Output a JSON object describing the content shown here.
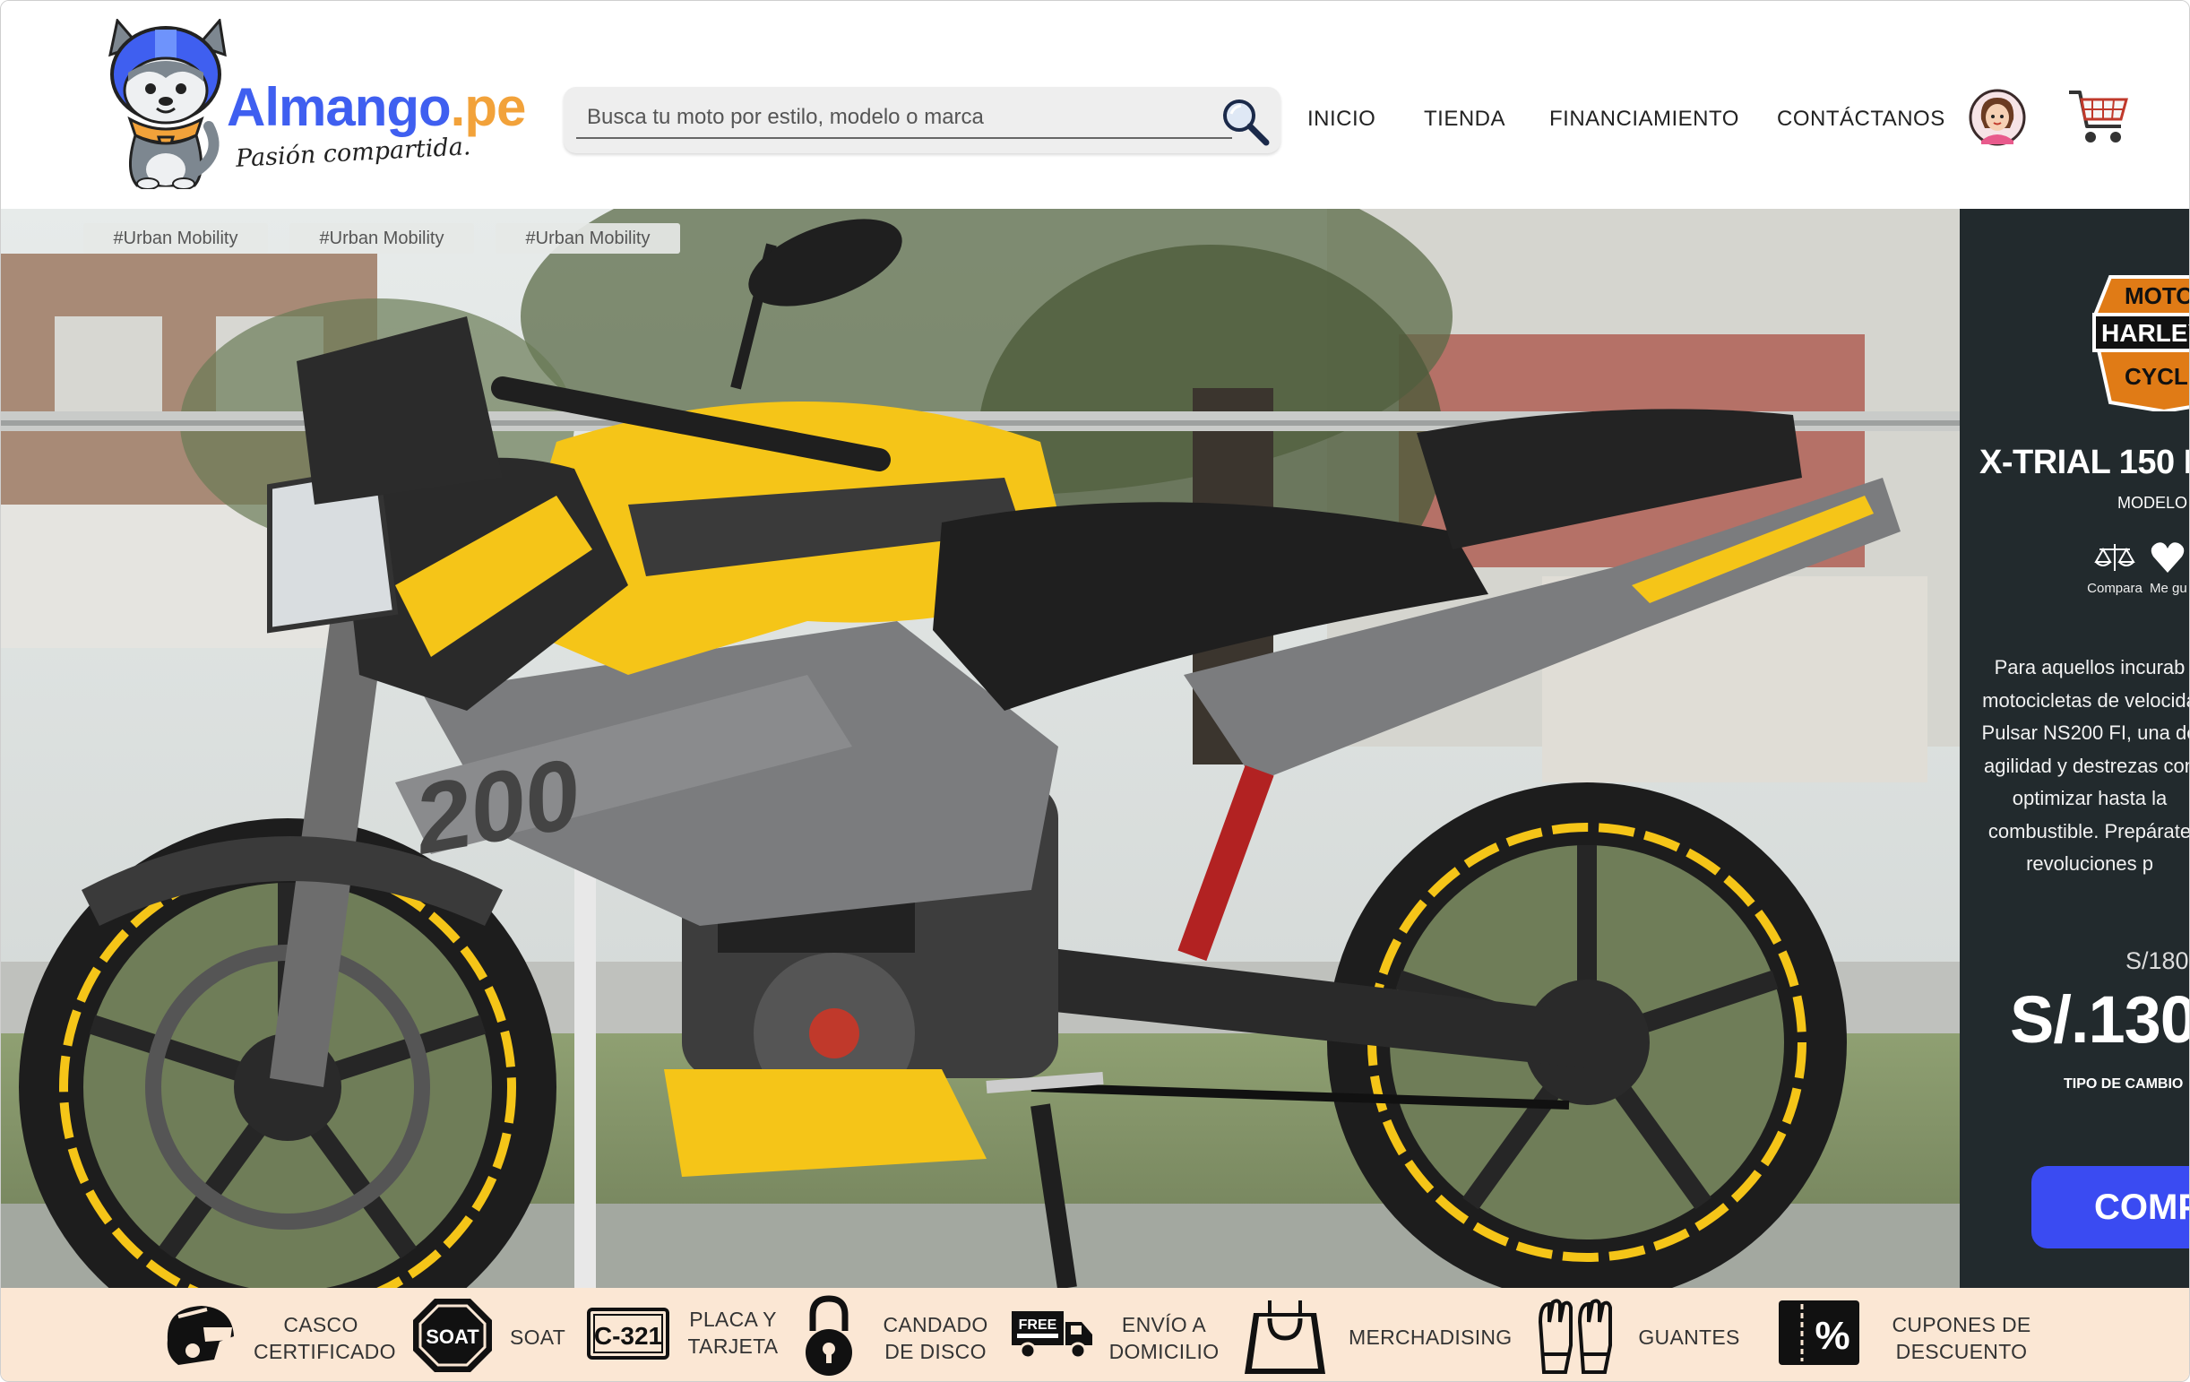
{
  "brand": {
    "name_main": "Almango",
    "name_suffix": ".pe",
    "tagline": "Pasión compartida."
  },
  "search": {
    "placeholder": "Busca tu moto por estilo, modelo o marca"
  },
  "nav": {
    "items": [
      {
        "label": "INICIO"
      },
      {
        "label": "TIENDA"
      },
      {
        "label": "FINANCIAMIENTO"
      },
      {
        "label": "CONTÁCTANOS"
      }
    ]
  },
  "hero": {
    "tags": [
      "#Urban Mobility",
      "#Urban Mobility",
      "#Urban Mobility"
    ]
  },
  "product": {
    "title": "X-TRIAL 150 I",
    "subtitle": "MODELO",
    "compare_label": "Compara",
    "like_label": "Me gu",
    "description_lines": [
      "Para aquellos incurab",
      "motocicletas de velocida",
      "Pulsar NS200 FI, una de",
      "agilidad y destrezas con",
      "optimizar hasta la",
      "combustible. Prepárate",
      "revoluciones p"
    ],
    "old_price": "S/180",
    "price": "S/.130",
    "exchange_note": "TIPO DE CAMBIO",
    "buy_label": "COMP"
  },
  "benefits": [
    {
      "icon": "helmet-icon",
      "line1": "CASCO",
      "line2": "CERTIFICADO"
    },
    {
      "icon": "soat-icon",
      "line1": "SOAT",
      "line2": ""
    },
    {
      "icon": "license-plate-icon",
      "plate_text": "C-321",
      "line1": "PLACA Y",
      "line2": "TARJETA"
    },
    {
      "icon": "padlock-icon",
      "line1": "CANDADO",
      "line2": "DE DISCO"
    },
    {
      "icon": "free-shipping-truck-icon",
      "truck_text": "FREE",
      "line1": "ENVÍO A",
      "line2": "DOMICILIO"
    },
    {
      "icon": "shopping-bag-icon",
      "line1": "MERCHADISING",
      "line2": ""
    },
    {
      "icon": "gloves-icon",
      "line1": "GUANTES",
      "line2": ""
    },
    {
      "icon": "discount-coupon-icon",
      "line1": "CUPONES DE",
      "line2": "DESCUENTO"
    }
  ],
  "colors": {
    "brand_blue": "#3f5ff0",
    "brand_orange": "#f2a23a",
    "panel_bg": "#222a2d",
    "buy_button": "#3a4bf2",
    "benefits_bg": "#fbe7d4",
    "moto_yellow": "#f5c518"
  }
}
